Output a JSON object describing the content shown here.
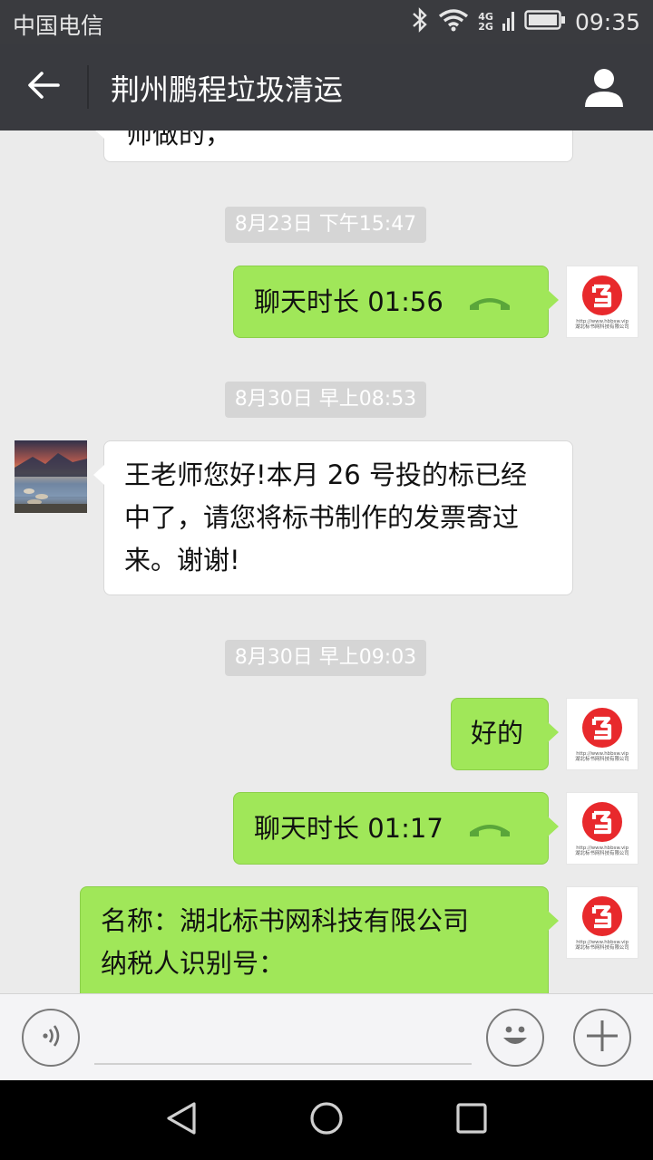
{
  "status_bar": {
    "carrier": "中国电信",
    "net_top": "4G",
    "net_bottom": "2G",
    "time": "09:35",
    "icons": [
      "bluetooth-icon",
      "wifi-icon",
      "signal-icon",
      "battery-icon"
    ]
  },
  "header": {
    "title": "荆州鹏程垃圾清运",
    "back_icon": "back-arrow-icon",
    "profile_icon": "person-icon",
    "bg_color": "#393a3f"
  },
  "chat": {
    "partial_top_text": "师做的，",
    "items": [
      {
        "type": "timestamp",
        "text": "8月23日 下午15:47"
      },
      {
        "type": "call",
        "direction": "out",
        "label": "聊天时长 01:56"
      },
      {
        "type": "timestamp",
        "text": "8月30日 早上08:53"
      },
      {
        "type": "message",
        "direction": "in",
        "lines": [
          "王老师您好!本月 26 号投的标已经",
          "中了，请您将标书制作的发票寄过",
          "来。谢谢!"
        ]
      },
      {
        "type": "timestamp",
        "text": "8月30日 早上09:03"
      },
      {
        "type": "message",
        "direction": "out",
        "lines": [
          "好的"
        ]
      },
      {
        "type": "call",
        "direction": "out",
        "label": "聊天时长 01:17"
      },
      {
        "type": "message",
        "direction": "out",
        "lines": [
          "名称：湖北标书网科技有限公司",
          "纳税人识别号："
        ]
      }
    ],
    "self_avatar": {
      "url_text": "http://www.hbbsw.vip",
      "company_text": "湖北标书网科技有限公司"
    },
    "colors": {
      "out_bubble": "#a0e759",
      "in_bubble": "#ffffff",
      "background": "#ebebeb",
      "call_icon": "#5aa63a",
      "logo_red": "#e8292c"
    }
  },
  "input_bar": {
    "voice_icon": "voice-icon",
    "emoji_icon": "emoji-icon",
    "plus_icon": "plus-icon",
    "placeholder": ""
  },
  "nav_bar": {
    "icons": [
      "nav-back-icon",
      "nav-home-icon",
      "nav-recent-icon"
    ]
  }
}
